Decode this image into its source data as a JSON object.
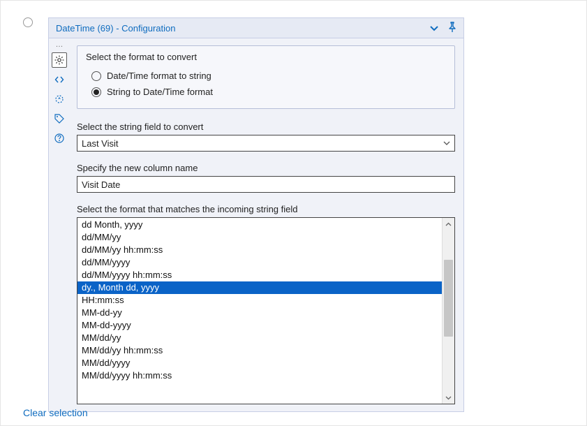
{
  "header": {
    "title": "DateTime (69) - Configuration"
  },
  "format_section": {
    "legend": "Select the format to convert",
    "option1": "Date/Time format to string",
    "option2": "String to Date/Time format"
  },
  "field_select": {
    "label": "Select the string field to convert",
    "value": "Last Visit"
  },
  "new_column": {
    "label": "Specify the new column name",
    "value": "Visit Date"
  },
  "match_format": {
    "label": "Select the format that matches the incoming string field",
    "options": [
      "dd Month, yyyy",
      "dd/MM/yy",
      "dd/MM/yy hh:mm:ss",
      "dd/MM/yyyy",
      "dd/MM/yyyy hh:mm:ss",
      "dy., Month dd, yyyy",
      "HH:mm:ss",
      "MM-dd-yy",
      "MM-dd-yyyy",
      "MM/dd/yy",
      "MM/dd/yy hh:mm:ss",
      "MM/dd/yyyy",
      "MM/dd/yyyy hh:mm:ss"
    ],
    "selected_index": 5
  },
  "footer": {
    "clear_selection": "Clear selection"
  }
}
